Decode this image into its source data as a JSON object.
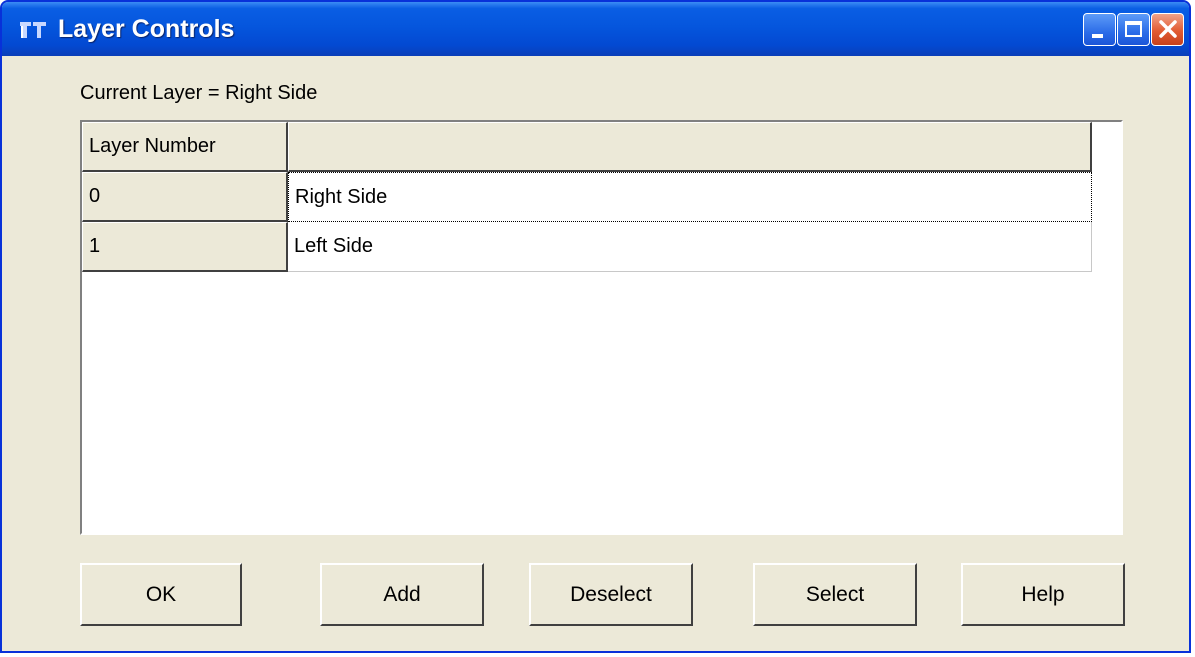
{
  "window": {
    "title": "Layer Controls",
    "controls": {
      "minimize": "minimize",
      "maximize": "maximize",
      "close": "close"
    }
  },
  "status": {
    "current_layer_text": "Current Layer = Right Side"
  },
  "grid": {
    "headers": [
      "Layer Number",
      ""
    ],
    "rows": [
      {
        "number": "0",
        "name": "Right Side"
      },
      {
        "number": "1",
        "name": "Left Side"
      }
    ]
  },
  "buttons": {
    "ok": "OK",
    "add": "Add",
    "deselect": "Deselect",
    "select": "Select",
    "help": "Help"
  },
  "colors": {
    "titlebar": "#0556dd",
    "window_face": "#ece9d8",
    "close_button": "#e25b32"
  },
  "icons": [
    "app-icon",
    "minimize-icon",
    "maximize-icon",
    "close-icon"
  ]
}
